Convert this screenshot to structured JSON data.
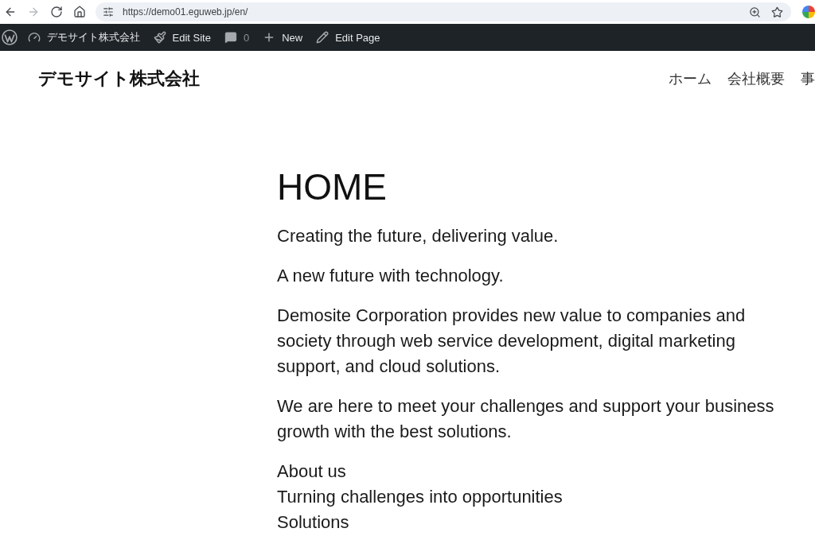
{
  "browser": {
    "nav_buttons": [
      {
        "kind": "back",
        "disabled": false
      },
      {
        "kind": "forward",
        "disabled": true
      },
      {
        "kind": "reload",
        "disabled": false
      },
      {
        "kind": "home",
        "disabled": false
      }
    ],
    "url": "https://demo01.eguweb.jp/en/"
  },
  "admin_bar": {
    "items": [
      {
        "kind": "wordpress"
      },
      {
        "kind": "site",
        "label": "デモサイト株式会社"
      },
      {
        "kind": "edit-site",
        "label": "Edit Site"
      },
      {
        "kind": "comments",
        "label": "0"
      },
      {
        "kind": "new",
        "label": "New"
      },
      {
        "kind": "edit-page",
        "label": "Edit Page"
      }
    ]
  },
  "header": {
    "site_title": "デモサイト株式会社",
    "nav": [
      {
        "label": "ホーム"
      },
      {
        "label": "会社概要"
      },
      {
        "label": "事"
      }
    ]
  },
  "content": {
    "title": "HOME",
    "paragraphs": [
      "Creating the future, delivering value.",
      "A new future with technology.",
      "Demosite Corporation provides new value to companies and society through web service development, digital marketing support, and cloud solutions.",
      "We are here to meet your challenges and support your business growth with the best solutions."
    ],
    "lines": [
      "About us",
      "Turning challenges into opportunities",
      "Solutions"
    ]
  }
}
